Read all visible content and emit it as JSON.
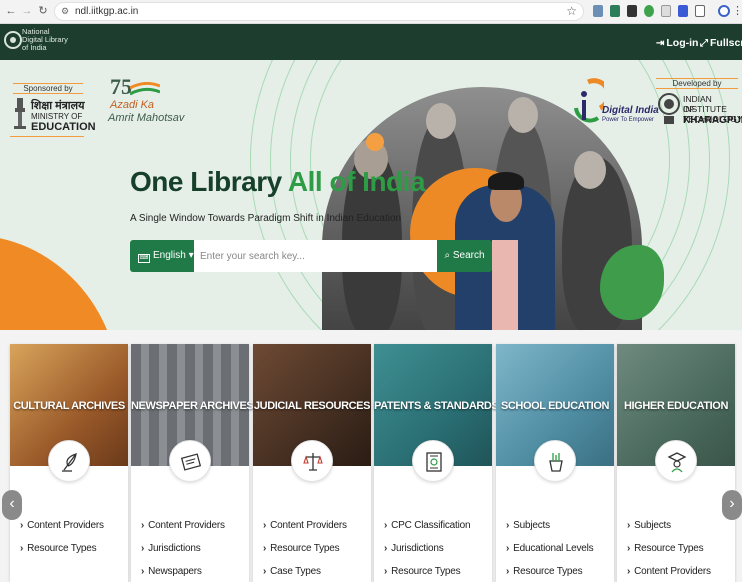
{
  "browser": {
    "url": "ndl.iitkgp.ac.in"
  },
  "header": {
    "logo_line1": "National",
    "logo_line2": "Digital Library",
    "logo_line3": "of India",
    "login_label": "Log-in",
    "fullscreen_label": "Fullscreen"
  },
  "hero": {
    "sponsored_by": "Sponsored by",
    "moe_hindi": "शिक्षा मंत्रालय",
    "moe_line1": "MINISTRY OF",
    "moe_line2": "EDUCATION",
    "azadi_75": "75",
    "azadi_line1": "Azadi Ka",
    "azadi_line2": "Amrit Mahotsav",
    "title_main": "One Library ",
    "title_accent": "All of India",
    "subtitle": "A Single Window Towards Paradigm Shift in Indian Education",
    "language": "English",
    "search_placeholder": "Enter your search key...",
    "search_label": "Search",
    "digital_india": "Digital India",
    "digital_india_tag": "Power To Empower",
    "developed_by": "Developed by",
    "iit_line1": "INDIAN INSTITUTE",
    "iit_line2": "OF TECHNOLOGY",
    "iit_line3": "KHARAGPUR"
  },
  "colors": {
    "header_bg": "#1d3e2f",
    "accent_green": "#207a48",
    "accent_orange": "#ee8a26"
  },
  "cards": [
    {
      "title": "CULTURAL ARCHIVES",
      "icon": "quill-icon",
      "links": [
        "Content Providers",
        "Resource Types"
      ]
    },
    {
      "title": "NEWSPAPER ARCHIVES",
      "icon": "newspaper-icon",
      "links": [
        "Content Providers",
        "Jurisdictions",
        "Newspapers"
      ]
    },
    {
      "title": "JUDICIAL RESOURCES",
      "icon": "scales-icon",
      "links": [
        "Content Providers",
        "Resource Types",
        "Case Types"
      ]
    },
    {
      "title": "PATENTS & STANDARDS",
      "icon": "certificate-icon",
      "links": [
        "CPC Classification",
        "Jurisdictions",
        "Resource Types"
      ]
    },
    {
      "title": "SCHOOL EDUCATION",
      "icon": "pencil-cup-icon",
      "links": [
        "Subjects",
        "Educational Levels",
        "Resource Types"
      ]
    },
    {
      "title": "HIGHER EDUCATION",
      "icon": "graduate-icon",
      "links": [
        "Subjects",
        "Resource Types",
        "Content Providers"
      ]
    }
  ],
  "carousel": {
    "prev": "‹",
    "next": "›"
  }
}
